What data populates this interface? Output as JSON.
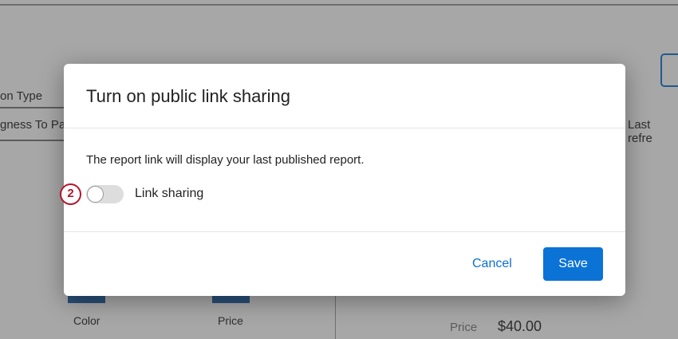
{
  "background": {
    "col_header": "on Type",
    "col_value": "gness To Pa",
    "last_refresh": "Last refre",
    "bar_labels": [
      "Color",
      "Price"
    ],
    "price_label": "Price",
    "price_value": "$40.00"
  },
  "modal": {
    "title": "Turn on public link sharing",
    "description": "The report link will display your last published report.",
    "toggle_label": "Link sharing",
    "toggle_on": false,
    "step_badge": "2",
    "cancel": "Cancel",
    "save": "Save"
  },
  "colors": {
    "accent": "#0b73d6",
    "badge": "#b5162b"
  }
}
